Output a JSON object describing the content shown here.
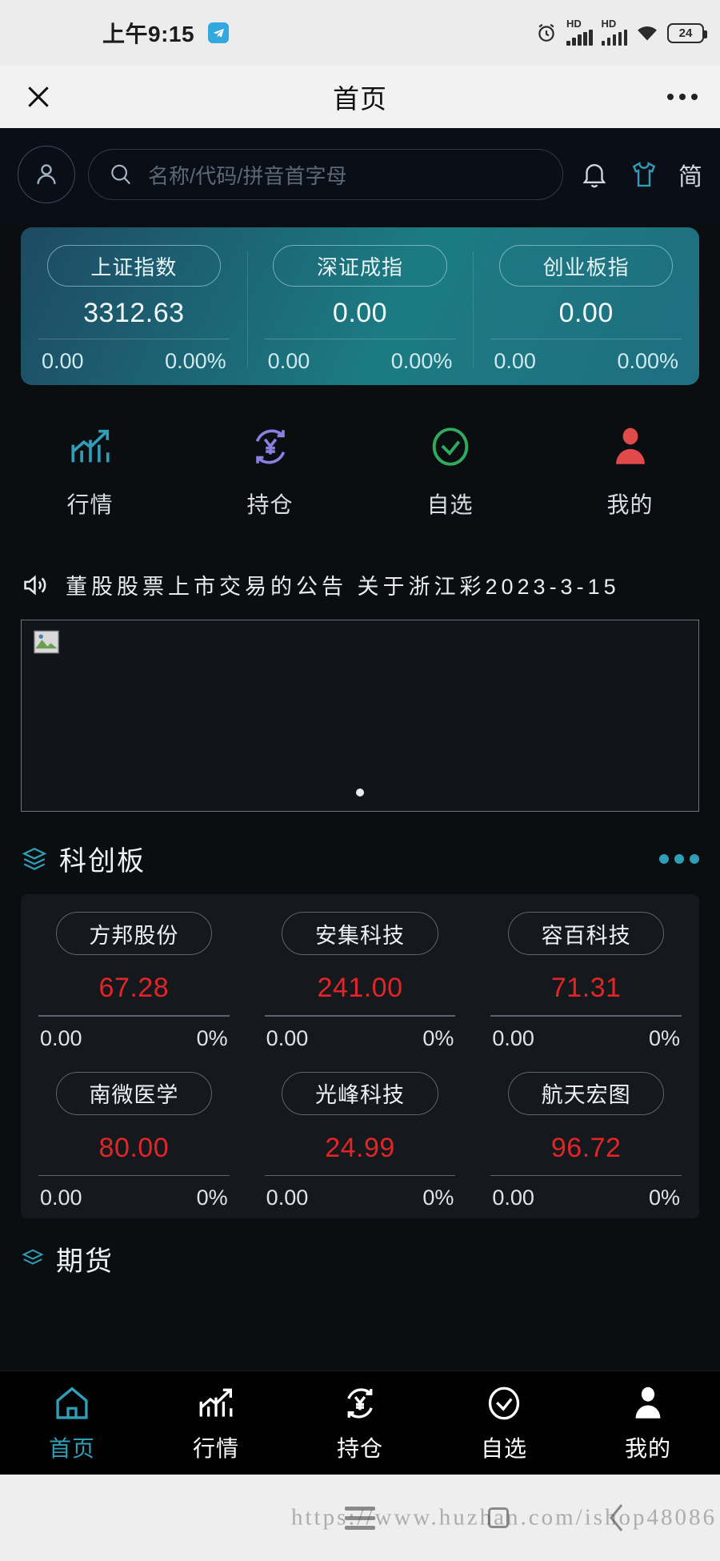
{
  "status_bar": {
    "time": "上午9:15",
    "telegram_icon": "telegram-icon",
    "alarm_icon": "alarm-icon",
    "signal_label_1": "HD",
    "signal_label_2": "HD",
    "wifi_icon": "wifi-icon",
    "battery_percent": "24"
  },
  "webview_header": {
    "close_label": "✕",
    "title": "首页",
    "more_label": "•••"
  },
  "search": {
    "avatar_icon": "user-avatar-icon",
    "placeholder": "名称/代码/拼音首字母",
    "search_icon": "search-icon",
    "bell_icon": "bell-icon",
    "shirt_icon": "shirt-icon",
    "language_toggle": "简"
  },
  "indices": [
    {
      "name": "上证指数",
      "value": "3312.63",
      "change": "0.00",
      "change_pct": "0.00%"
    },
    {
      "name": "深证成指",
      "value": "0.00",
      "change": "0.00",
      "change_pct": "0.00%"
    },
    {
      "name": "创业板指",
      "value": "0.00",
      "change": "0.00",
      "change_pct": "0.00%"
    }
  ],
  "quick_actions": [
    {
      "label": "行情",
      "icon": "chart-trend-icon",
      "color": "#2f9fb8"
    },
    {
      "label": "持仓",
      "icon": "yuan-refresh-icon",
      "color": "#8d7fe0"
    },
    {
      "label": "自选",
      "icon": "check-circle-icon",
      "color": "#2faa5e"
    },
    {
      "label": "我的",
      "icon": "user-person-icon",
      "color": "#e04a4a"
    }
  ],
  "news": {
    "speaker_icon": "speaker-icon",
    "text": "董股股票上市交易的公告  关于浙江彩2023-3-15"
  },
  "banner": {
    "broken_image_icon": "broken-image-icon",
    "dot_indicator": "carousel-dot"
  },
  "section": {
    "icon": "layers-icon",
    "title": "科创板",
    "more_icon": "more-dots-icon",
    "next_title": "期货"
  },
  "stocks": [
    [
      {
        "name": "方邦股份",
        "price": "67.28",
        "change": "0.00",
        "change_pct": "0%"
      },
      {
        "name": "安集科技",
        "price": "241.00",
        "change": "0.00",
        "change_pct": "0%"
      },
      {
        "name": "容百科技",
        "price": "71.31",
        "change": "0.00",
        "change_pct": "0%"
      }
    ],
    [
      {
        "name": "南微医学",
        "price": "80.00",
        "change": "0.00",
        "change_pct": "0%"
      },
      {
        "name": "光峰科技",
        "price": "24.99",
        "change": "0.00",
        "change_pct": "0%"
      },
      {
        "name": "航天宏图",
        "price": "96.72",
        "change": "0.00",
        "change_pct": "0%"
      }
    ]
  ],
  "tabbar": [
    {
      "label": "首页",
      "icon": "home-icon",
      "active": true
    },
    {
      "label": "行情",
      "icon": "chart-trend-icon",
      "active": false
    },
    {
      "label": "持仓",
      "icon": "yuan-refresh-icon",
      "active": false
    },
    {
      "label": "自选",
      "icon": "check-circle-icon",
      "active": false
    },
    {
      "label": "我的",
      "icon": "user-person-icon",
      "active": false
    }
  ],
  "navbar": {
    "menu_icon": "menu-icon",
    "square_icon": "square-icon",
    "back_icon": "back-icon"
  },
  "watermark": "https://www.huzhan.com/ishop48086",
  "colors": {
    "price_up": "#e02626",
    "accent": "#2f9fb8",
    "index_card_from": "#1d4a63",
    "index_card_to": "#1f6f80"
  }
}
